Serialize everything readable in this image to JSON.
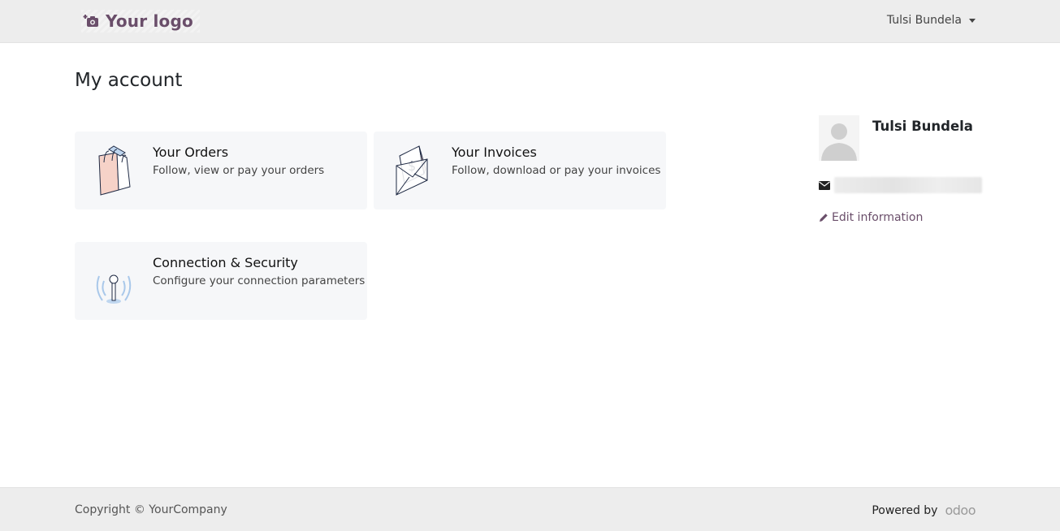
{
  "navbar": {
    "logo_text": "Your logo",
    "user_name": "Tulsi Bundela"
  },
  "page": {
    "title": "My account"
  },
  "cards": [
    {
      "title": "Your Orders",
      "description": "Follow, view or pay your orders",
      "icon": "shopping-bag-icon"
    },
    {
      "title": "Your Invoices",
      "description": "Follow, download or pay your invoices",
      "icon": "invoice-envelope-icon"
    },
    {
      "title": "Connection & Security",
      "description": "Configure your connection parameters",
      "icon": "antenna-icon"
    }
  ],
  "sidebar": {
    "name": "Tulsi Bundela",
    "edit_label": "Edit information"
  },
  "footer": {
    "copyright": "Copyright © YourCompany",
    "powered_by": "Powered by",
    "brand": "odoo"
  },
  "colors": {
    "brand": "#6a4e6a",
    "navbar_bg": "#ededed",
    "card_bg": "#f6f7f9"
  }
}
